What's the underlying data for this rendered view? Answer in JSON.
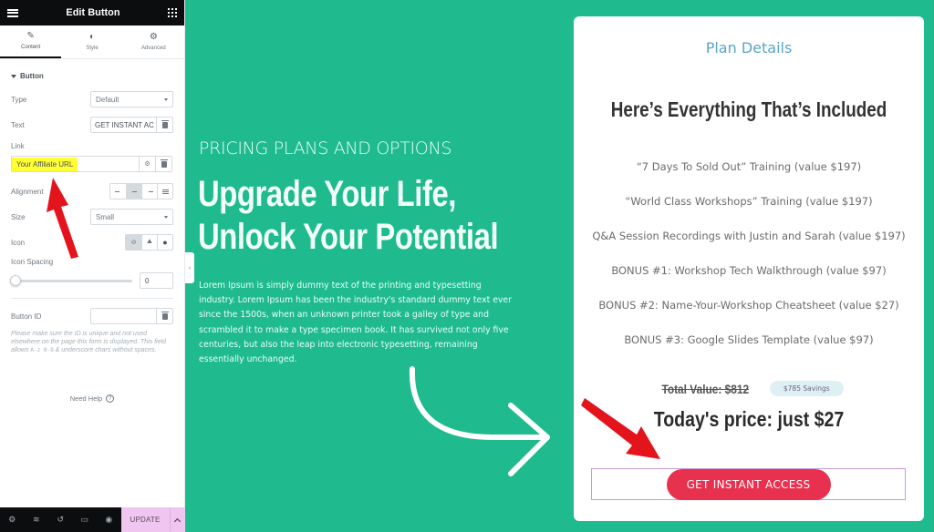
{
  "editor": {
    "title": "Edit Button",
    "tabs": [
      {
        "label": "Content",
        "icon": "pencil-icon",
        "active": true
      },
      {
        "label": "Style",
        "icon": "contrast-icon",
        "active": false
      },
      {
        "label": "Advanced",
        "icon": "gear-icon",
        "active": false
      }
    ],
    "section": "Button",
    "fields": {
      "type": {
        "label": "Type",
        "value": "Default"
      },
      "text": {
        "label": "Text",
        "value": "GET INSTANT AC"
      },
      "link": {
        "label": "Link",
        "value": "Your Affiliate URL"
      },
      "alignment": {
        "label": "Alignment",
        "options": [
          "left",
          "center",
          "right",
          "justify"
        ],
        "selected": "center"
      },
      "size": {
        "label": "Size",
        "value": "Small"
      },
      "icon": {
        "label": "Icon",
        "options": [
          "none",
          "upload",
          "icon-library"
        ],
        "selected": "none"
      },
      "icon_spacing": {
        "label": "Icon Spacing",
        "value": "0"
      },
      "button_id": {
        "label": "Button ID",
        "value": ""
      }
    },
    "note_parts": [
      "Please make sure the ID is unique and not used elsewhere on the page this form is displayed. This field allows ",
      "A-z 0-9",
      " & underscore chars without spaces."
    ],
    "help": "Need Help",
    "footer": {
      "icons": [
        "settings-icon",
        "layers-icon",
        "history-icon",
        "responsive-icon",
        "preview-icon"
      ],
      "update_label": "UPDATE"
    }
  },
  "hero": {
    "eyebrow": "PRICING PLANS AND OPTIONS",
    "headline_line1": "Upgrade Your Life,",
    "headline_line2": "Unlock Your Potential",
    "body": "Lorem Ipsum is simply dummy text of the printing and typesetting industry. Lorem Ipsum has been the industry's standard dummy text ever since the 1500s, when an unknown printer took a galley of type and scrambled it to make a type specimen book. It has survived not only five centuries, but also the leap into electronic typesetting, remaining essentially unchanged."
  },
  "plan": {
    "label": "Plan Details",
    "heading": "Here’s Everything That’s Included",
    "features": [
      "“7 Days To Sold Out” Training (value $197)",
      "“World Class Workshops” Training (value $197)",
      "Q&A Session Recordings with Justin and Sarah (value $197)",
      "BONUS #1: Workshop Tech Walkthrough (value $97)",
      "BONUS #2: Name-Your-Workshop Cheatsheet (value $27)",
      "BONUS #3: Google Slides Template (value $97)"
    ],
    "total_value": "Total Value: $812",
    "savings": "$785 Savings",
    "today_price": "Today's price: just $27",
    "cta": "GET INSTANT ACCESS"
  },
  "colors": {
    "background": "#1fba8e",
    "cta": "#e8304f",
    "plan_label": "#58a6c8",
    "update_button": "#f0c6f0",
    "link_highlight": "#ffff33",
    "annotation_arrow": "#e3141b"
  }
}
